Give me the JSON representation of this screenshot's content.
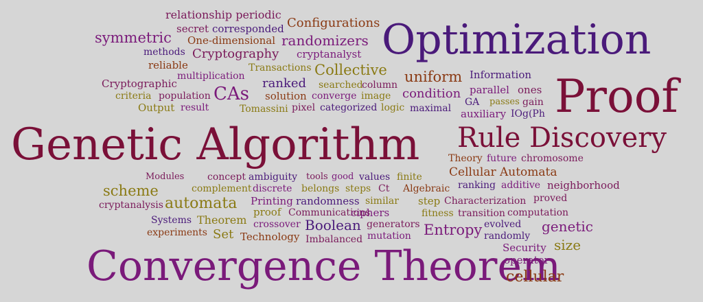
{
  "colors": {
    "background": "#d6d6d6",
    "maroon": "#7a1038",
    "purple": "#4a1a7a",
    "violet": "#7a1a7a",
    "olive": "#8a7a14",
    "brown": "#8a3a14",
    "plum": "#7a1a5a"
  },
  "words": [
    {
      "text": "relationship periodic",
      "color": "#7a1a5a"
    },
    {
      "text": "Configurations",
      "color": "#8a3a14"
    },
    {
      "text": "secret",
      "color": "#7a1a5a"
    },
    {
      "text": "corresponded",
      "color": "#4a1a7a"
    },
    {
      "text": "symmetric",
      "color": "#7a1a7a"
    },
    {
      "text": "One-dimensional",
      "color": "#8a3a14"
    },
    {
      "text": "randomizers",
      "color": "#7a1a7a"
    },
    {
      "text": "Optimization",
      "color": "#4a1a7a"
    },
    {
      "text": "methods",
      "color": "#4a1a7a"
    },
    {
      "text": "Cryptography",
      "color": "#7a1a5a"
    },
    {
      "text": "cryptanalyst",
      "color": "#7a1a7a"
    },
    {
      "text": "reliable",
      "color": "#8a3a14"
    },
    {
      "text": "Transactions",
      "color": "#8a7a14"
    },
    {
      "text": "Collective",
      "color": "#8a7a14"
    },
    {
      "text": "multiplication",
      "color": "#7a1a7a"
    },
    {
      "text": "uniform",
      "color": "#8a3a14"
    },
    {
      "text": "Information",
      "color": "#4a1a7a"
    },
    {
      "text": "Proof",
      "color": "#7a1038"
    },
    {
      "text": "Cryptographic",
      "color": "#7a1a5a"
    },
    {
      "text": "ranked",
      "color": "#4a1a7a"
    },
    {
      "text": "searched",
      "color": "#8a7a14"
    },
    {
      "text": "column",
      "color": "#7a1a5a"
    },
    {
      "text": "CAs",
      "color": "#7a1a7a"
    },
    {
      "text": "parallel",
      "color": "#7a1a7a"
    },
    {
      "text": "ones",
      "color": "#7a1a5a"
    },
    {
      "text": "criteria",
      "color": "#8a7a14"
    },
    {
      "text": "population",
      "color": "#7a1a5a"
    },
    {
      "text": "solution",
      "color": "#8a3a14"
    },
    {
      "text": "converge",
      "color": "#7a1a7a"
    },
    {
      "text": "image",
      "color": "#8a7a14"
    },
    {
      "text": "condition",
      "color": "#7a1a7a"
    },
    {
      "text": "GA",
      "color": "#4a1a7a"
    },
    {
      "text": "passes",
      "color": "#8a7a14"
    },
    {
      "text": "gain",
      "color": "#7a1a5a"
    },
    {
      "text": "Output",
      "color": "#8a7a14"
    },
    {
      "text": "result",
      "color": "#7a1a7a"
    },
    {
      "text": "Tomassini",
      "color": "#8a7a14"
    },
    {
      "text": "pixel",
      "color": "#7a1a5a"
    },
    {
      "text": "categorized",
      "color": "#4a1a7a"
    },
    {
      "text": "logic",
      "color": "#8a7a14"
    },
    {
      "text": "maximal",
      "color": "#4a1a7a"
    },
    {
      "text": "auxiliary",
      "color": "#7a1a7a"
    },
    {
      "text": "IOg(Ph",
      "color": "#4a1a7a"
    },
    {
      "text": "Genetic Algorithm",
      "color": "#7a1038"
    },
    {
      "text": "Rule Discovery",
      "color": "#7a1038"
    },
    {
      "text": "Theory",
      "color": "#8a3a14"
    },
    {
      "text": "future",
      "color": "#7a1a7a"
    },
    {
      "text": "chromosome",
      "color": "#7a1a5a"
    },
    {
      "text": "Cellular Automata",
      "color": "#8a3a14"
    },
    {
      "text": "Modules",
      "color": "#7a1a5a"
    },
    {
      "text": "concept",
      "color": "#7a1a5a"
    },
    {
      "text": "ambiguity",
      "color": "#4a1a7a"
    },
    {
      "text": "tools",
      "color": "#7a1a5a"
    },
    {
      "text": "good",
      "color": "#7a1a7a"
    },
    {
      "text": "values",
      "color": "#4a1a7a"
    },
    {
      "text": "finite",
      "color": "#8a7a14"
    },
    {
      "text": "ranking",
      "color": "#4a1a7a"
    },
    {
      "text": "additive",
      "color": "#7a1a7a"
    },
    {
      "text": "neighborhood",
      "color": "#7a1a5a"
    },
    {
      "text": "scheme",
      "color": "#8a7a14"
    },
    {
      "text": "complement",
      "color": "#8a7a14"
    },
    {
      "text": "discrete",
      "color": "#7a1a7a"
    },
    {
      "text": "belongs",
      "color": "#8a7a14"
    },
    {
      "text": "steps",
      "color": "#8a7a14"
    },
    {
      "text": "Ct",
      "color": "#7a1a5a"
    },
    {
      "text": "Algebraic",
      "color": "#8a3a14"
    },
    {
      "text": "proved",
      "color": "#7a1a5a"
    },
    {
      "text": "cryptanalysis",
      "color": "#7a1a5a"
    },
    {
      "text": "automata",
      "color": "#8a7a14"
    },
    {
      "text": "Printing",
      "color": "#7a1a7a"
    },
    {
      "text": "randomness",
      "color": "#4a1a7a"
    },
    {
      "text": "similar",
      "color": "#8a7a14"
    },
    {
      "text": "step",
      "color": "#8a7a14"
    },
    {
      "text": "Characterization",
      "color": "#7a1a5a"
    },
    {
      "text": "computation",
      "color": "#7a1a5a"
    },
    {
      "text": "proof",
      "color": "#8a7a14"
    },
    {
      "text": "Communications",
      "color": "#7a1a5a"
    },
    {
      "text": "ciphers",
      "color": "#7a1a7a"
    },
    {
      "text": "fitness",
      "color": "#8a7a14"
    },
    {
      "text": "transition",
      "color": "#7a1a5a"
    },
    {
      "text": "Systems",
      "color": "#4a1a7a"
    },
    {
      "text": "Theorem",
      "color": "#8a7a14"
    },
    {
      "text": "crossover",
      "color": "#7a1a7a"
    },
    {
      "text": "Boolean",
      "color": "#4a1a7a"
    },
    {
      "text": "generators",
      "color": "#7a1a5a"
    },
    {
      "text": "evolved",
      "color": "#4a1a7a"
    },
    {
      "text": "genetic",
      "color": "#7a1a7a"
    },
    {
      "text": "experiments",
      "color": "#8a3a14"
    },
    {
      "text": "Set",
      "color": "#8a7a14"
    },
    {
      "text": "Technology",
      "color": "#8a3a14"
    },
    {
      "text": "Imbalanced",
      "color": "#7a1a5a"
    },
    {
      "text": "mutation",
      "color": "#7a1a7a"
    },
    {
      "text": "Entropy",
      "color": "#7a1a7a"
    },
    {
      "text": "randomly",
      "color": "#4a1a7a"
    },
    {
      "text": "size",
      "color": "#8a7a14"
    },
    {
      "text": "Security",
      "color": "#7a1a7a"
    },
    {
      "text": "Convergence Theorem",
      "color": "#7a1a7a"
    },
    {
      "text": "operator",
      "color": "#7a1a7a"
    },
    {
      "text": "cellular",
      "color": "#8a3a14"
    }
  ]
}
